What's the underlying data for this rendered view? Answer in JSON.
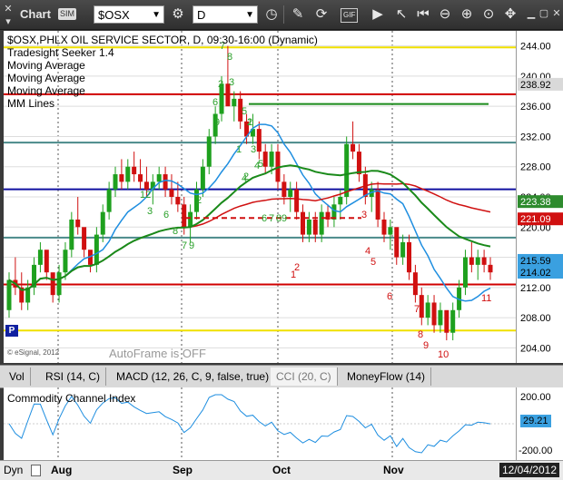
{
  "toolbar": {
    "title": "Chart",
    "badge": "SIM",
    "symbol": "$OSX",
    "interval": "D",
    "gif_label": "GIF"
  },
  "legend": {
    "header": "$OSX,PHLX OIL SERVICE SECTOR, D, 09:30-16:00 (Dynamic)",
    "line2": "Tradesight Seeker 1.4",
    "line3": "Moving Average",
    "line4": "Moving Average",
    "line5": "Moving Average",
    "line6": "MM Lines"
  },
  "watermark": "© eSignal, 2012",
  "autoframe": "AutoFrame is OFF",
  "tabs": [
    {
      "label": "Vol"
    },
    {
      "label": "RSI (14, C)"
    },
    {
      "label": "MACD (12, 26, C, 9, false, true)"
    },
    {
      "label": "CCI (20, C)"
    },
    {
      "label": "MoneyFlow (14)"
    }
  ],
  "cci_title": "Commodity Channel Index",
  "cci_value": "29.21",
  "cci_ticks": [
    "200.00",
    "-200.00"
  ],
  "date_axis": {
    "dyn": "Dyn",
    "labels": [
      "Aug",
      "Sep",
      "Oct",
      "Nov"
    ],
    "current_date": "12/04/2012"
  },
  "price_tags": [
    {
      "value": "238.92",
      "bg": "#d9d9d9",
      "fg": "#000000"
    },
    {
      "value": "223.38",
      "bg": "#2e8b2e",
      "fg": "#ffffff"
    },
    {
      "value": "221.09",
      "bg": "#d01010",
      "fg": "#ffffff"
    },
    {
      "value": "215.59",
      "bg": "#3aa0e0",
      "fg": "#000000"
    },
    {
      "value": "214.02",
      "bg": "#3aa0e0",
      "fg": "#000000"
    }
  ],
  "chart_data": {
    "type": "candlestick",
    "ylim": [
      202,
      246
    ],
    "y_ticks": [
      204,
      208,
      212,
      216,
      220,
      224,
      228,
      232,
      236,
      240,
      244
    ],
    "x_labels": [
      "Aug",
      "Sep",
      "Oct",
      "Nov"
    ],
    "horizontal_levels": [
      {
        "y": 243.8,
        "color": "#f0e000"
      },
      {
        "y": 237.6,
        "color": "#d00000"
      },
      {
        "y": 231.2,
        "color": "#4a8a8a"
      },
      {
        "y": 225.0,
        "color": "#1010a0"
      },
      {
        "y": 218.6,
        "color": "#4a8a8a"
      },
      {
        "y": 212.4,
        "color": "#d00000"
      },
      {
        "y": 206.3,
        "color": "#f0e000"
      }
    ],
    "candles": [
      [
        209,
        214,
        208,
        213
      ],
      [
        213,
        216,
        211,
        212
      ],
      [
        212,
        214,
        209,
        210
      ],
      [
        210,
        213,
        209,
        212
      ],
      [
        212,
        216,
        211,
        215
      ],
      [
        215,
        218,
        214,
        217
      ],
      [
        217,
        216,
        213,
        214
      ],
      [
        214,
        213,
        210,
        211
      ],
      [
        211,
        215,
        210,
        214
      ],
      [
        214,
        218,
        213,
        217
      ],
      [
        217,
        222,
        216,
        221
      ],
      [
        221,
        224,
        219,
        220
      ],
      [
        220,
        219,
        216,
        217
      ],
      [
        217,
        216,
        214,
        215
      ],
      [
        215,
        220,
        214,
        219
      ],
      [
        219,
        223,
        218,
        222
      ],
      [
        222,
        226,
        221,
        225
      ],
      [
        225,
        228,
        224,
        227
      ],
      [
        227,
        229,
        225,
        226
      ],
      [
        226,
        229,
        225,
        228
      ],
      [
        228,
        230,
        226,
        227
      ],
      [
        227,
        229,
        225,
        226
      ],
      [
        226,
        228,
        224,
        225
      ],
      [
        225,
        227,
        223,
        226
      ],
      [
        226,
        228,
        225,
        227
      ],
      [
        227,
        228,
        224,
        225
      ],
      [
        225,
        227,
        223,
        224
      ],
      [
        224,
        226,
        222,
        223
      ],
      [
        223,
        224,
        219,
        220
      ],
      [
        220,
        223,
        218,
        222
      ],
      [
        222,
        226,
        221,
        225
      ],
      [
        225,
        229,
        224,
        228
      ],
      [
        228,
        233,
        227,
        232
      ],
      [
        232,
        236,
        231,
        235
      ],
      [
        235,
        240,
        234,
        239
      ],
      [
        239,
        244,
        237,
        236
      ],
      [
        236,
        238,
        234,
        237
      ],
      [
        237,
        238,
        233,
        234
      ],
      [
        234,
        235,
        231,
        232
      ],
      [
        232,
        235,
        231,
        233
      ],
      [
        233,
        234,
        229,
        230
      ],
      [
        230,
        231,
        227,
        228
      ],
      [
        228,
        231,
        227,
        230
      ],
      [
        230,
        231,
        225,
        226
      ],
      [
        226,
        227,
        223,
        224
      ],
      [
        224,
        226,
        222,
        225
      ],
      [
        225,
        226,
        221,
        222
      ],
      [
        222,
        223,
        218,
        219
      ],
      [
        219,
        222,
        218,
        221
      ],
      [
        221,
        222,
        218,
        219
      ],
      [
        219,
        223,
        218,
        222
      ],
      [
        222,
        223,
        220,
        221
      ],
      [
        221,
        224,
        220,
        223
      ],
      [
        223,
        225,
        221,
        224
      ],
      [
        224,
        232,
        223,
        231
      ],
      [
        231,
        234,
        229,
        230
      ],
      [
        230,
        231,
        226,
        227
      ],
      [
        227,
        228,
        223,
        224
      ],
      [
        224,
        226,
        222,
        225
      ],
      [
        225,
        226,
        220,
        221
      ],
      [
        221,
        222,
        218,
        219
      ],
      [
        219,
        221,
        217,
        220
      ],
      [
        220,
        219,
        215,
        216
      ],
      [
        216,
        219,
        215,
        218
      ],
      [
        218,
        219,
        213,
        214
      ],
      [
        214,
        215,
        210,
        211
      ],
      [
        211,
        212,
        207,
        208
      ],
      [
        208,
        211,
        207,
        210
      ],
      [
        210,
        211,
        206,
        207
      ],
      [
        207,
        210,
        206,
        209
      ],
      [
        209,
        208,
        205,
        206
      ],
      [
        206,
        210,
        205,
        209
      ],
      [
        209,
        213,
        208,
        212
      ],
      [
        212,
        217,
        211,
        216
      ],
      [
        216,
        218,
        214,
        215
      ],
      [
        215,
        217,
        213,
        216
      ],
      [
        216,
        217,
        214,
        215
      ],
      [
        215,
        216,
        213,
        214
      ]
    ],
    "annotations_green": [
      "7",
      "8",
      "2",
      "3",
      "6",
      "9",
      "5",
      "1",
      "3",
      "2",
      "4",
      "12",
      "3",
      "6",
      "8",
      "7",
      "9",
      "2",
      "4",
      "5",
      "6",
      "7",
      "8",
      "9",
      "1",
      "2"
    ],
    "annotations_red": [
      "1",
      "2",
      "3",
      "4",
      "5",
      "6",
      "7",
      "8",
      "9",
      "10",
      "11"
    ]
  }
}
